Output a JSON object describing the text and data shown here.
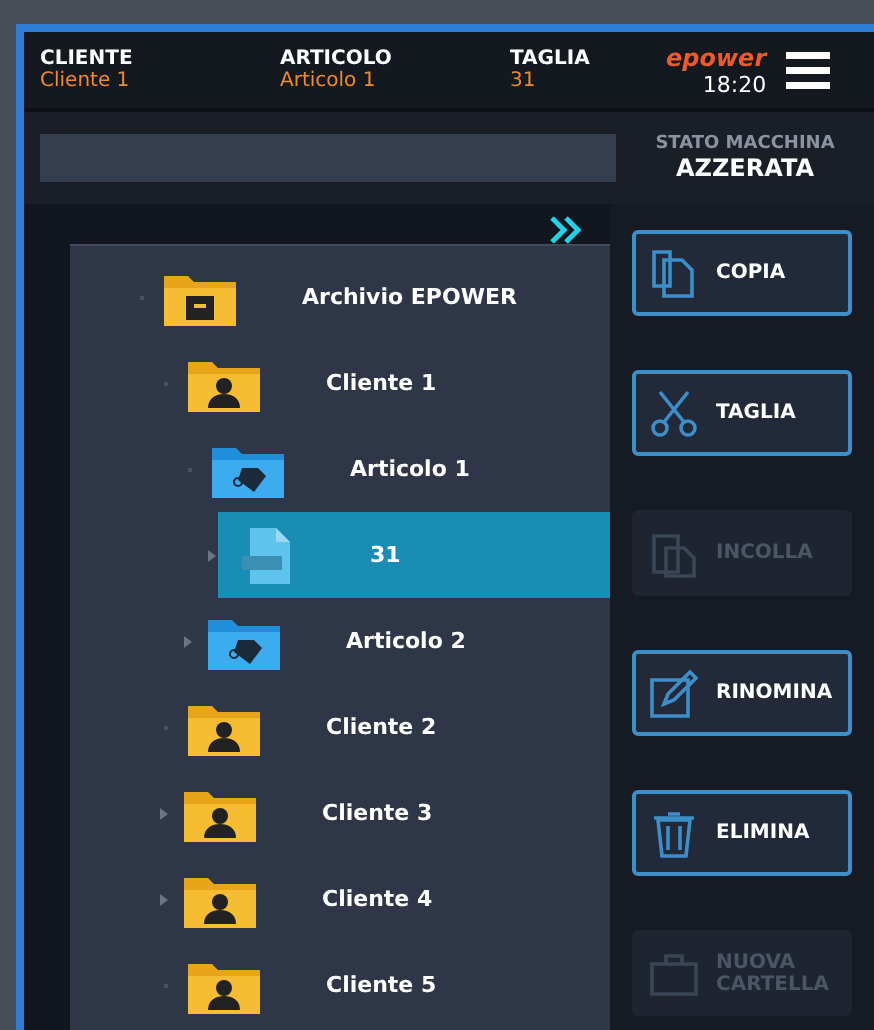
{
  "header": {
    "fields": [
      {
        "label": "CLIENTE",
        "value": "Cliente 1"
      },
      {
        "label": "ARTICOLO",
        "value": "Articolo 1"
      },
      {
        "label": "TAGLIA",
        "value": "31"
      }
    ],
    "logo": "epower",
    "time": "18:20"
  },
  "status": {
    "label": "STATO MACCHINA",
    "value": "AZZERATA"
  },
  "tree": [
    {
      "label": "Archivio EPOWER",
      "kind": "archive",
      "expandable": false,
      "selected": false,
      "children": [
        {
          "label": "Cliente 1",
          "kind": "client",
          "expandable": false,
          "selected": false,
          "children": [
            {
              "label": "Articolo 1",
              "kind": "article",
              "expandable": false,
              "selected": false,
              "children": [
                {
                  "label": "31",
                  "kind": "file",
                  "expandable": true,
                  "selected": true
                }
              ]
            },
            {
              "label": "Articolo 2",
              "kind": "article",
              "expandable": true,
              "selected": false
            }
          ]
        },
        {
          "label": "Cliente 2",
          "kind": "client",
          "expandable": false,
          "selected": false
        },
        {
          "label": "Cliente 3",
          "kind": "client",
          "expandable": true,
          "selected": false
        },
        {
          "label": "Cliente 4",
          "kind": "client",
          "expandable": true,
          "selected": false
        },
        {
          "label": "Cliente 5",
          "kind": "client",
          "expandable": false,
          "selected": false
        }
      ]
    }
  ],
  "actions": [
    {
      "label": "COPIA",
      "kind": "copy",
      "disabled": false
    },
    {
      "label": "TAGLIA",
      "kind": "cut",
      "disabled": false
    },
    {
      "label": "INCOLLA",
      "kind": "paste",
      "disabled": true
    },
    {
      "label": "RINOMINA",
      "kind": "rename",
      "disabled": false
    },
    {
      "label": "ELIMINA",
      "kind": "delete",
      "disabled": false
    },
    {
      "label": "NUOVA CARTELLA",
      "kind": "folder",
      "disabled": true
    }
  ]
}
